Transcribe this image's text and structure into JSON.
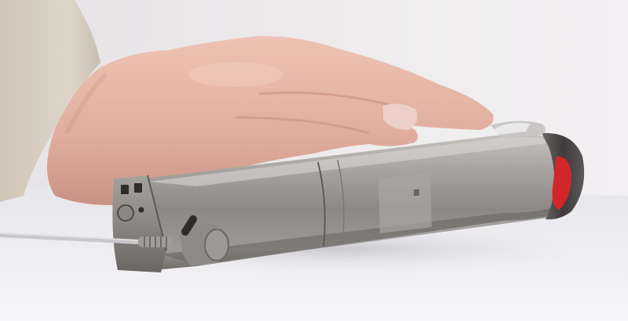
{
  "photo": {
    "subject": "handheld-stick-vacuum-battery",
    "colors": {
      "wall": "#e9e7e9",
      "table": "#f4f3f6",
      "sleeve": "#d9cfc2",
      "skin": "#e3b6a6",
      "skin_shadow": "#c98f82",
      "metal_light": "#b4b0ad",
      "metal_mid": "#8f8b87",
      "metal_dark": "#5d5956",
      "end_cap": "#4a4647",
      "indicator_red": "#d0282b",
      "cable": "#c6c6c8",
      "connector": "#938f8a"
    }
  }
}
